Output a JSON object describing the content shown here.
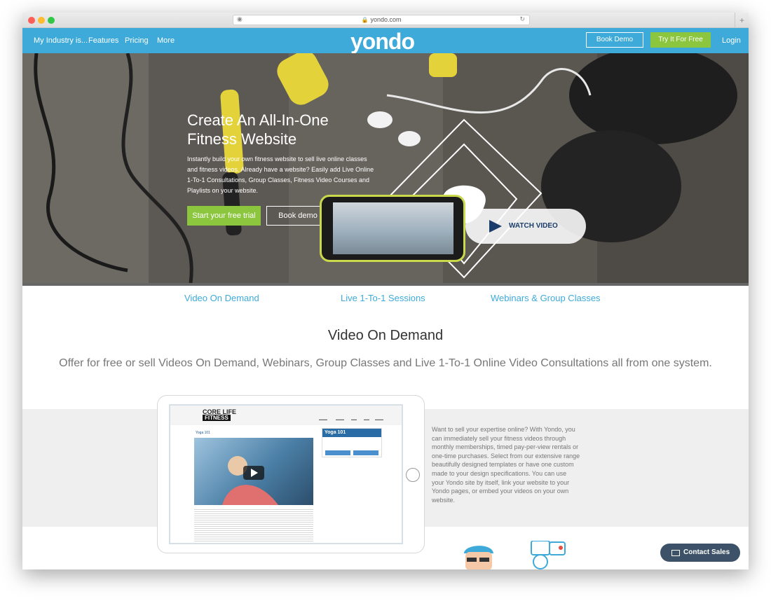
{
  "browser": {
    "url": "yondo.com"
  },
  "nav": {
    "industry": "My Industry is...",
    "features": "Features",
    "pricing": "Pricing",
    "more": "More",
    "logo": "yondo",
    "book_demo": "Book Demo",
    "try_free": "Try It For Free",
    "login": "Login"
  },
  "hero": {
    "title_line1": "Create An All-In-One",
    "title_line2": "Fitness Website",
    "description": "Instantly build your own fitness website to sell live online classes and fitness videos. Already have a website? Easily add Live Online 1-To-1 Consultations, Group Classes, Fitness Video Courses and Playlists on your website.",
    "start_trial": "Start your free trial",
    "book_demo": "Book demo",
    "watch_video": "WATCH VIDEO"
  },
  "tabs": {
    "vod": "Video On Demand",
    "live": "Live 1-To-1 Sessions",
    "webinars": "Webinars & Group Classes"
  },
  "section": {
    "title": "Video  On Demand",
    "subtitle": "Offer for free or sell Videos On Demand, Webinars, Group Classes and Live 1-To-1 Online Video Consultations all from one system.",
    "description": "Want to sell your expertise online? With Yondo, you can immediately sell your fitness videos through monthly memberships, timed pay-per-view rentals or one-time purchases. Select from our extensive range beautifully designed templates or have one custom made to your design specifications. You can use your Yondo site by itself, link your website to your Yondo pages, or embed your videos on your own website."
  },
  "tablet": {
    "logo_top": "CORE LIFE",
    "logo_bottom": "FITNESS",
    "card_title": "Yoga 101",
    "panel_title": "Yoga 101"
  },
  "contact": {
    "label": "Contact Sales"
  },
  "colors": {
    "brand_blue": "#3eaad9",
    "green": "#8cc63f",
    "dark": "#3d5268"
  }
}
